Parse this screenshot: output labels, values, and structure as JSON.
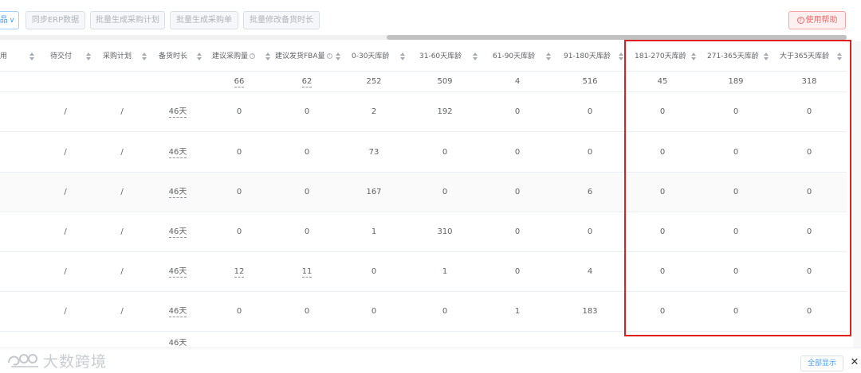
{
  "toolbar": {
    "filter_label": "品",
    "buttons": [
      "同步ERP数据",
      "批量生成采购计划",
      "批量生成采购单",
      "批量修改备货时长"
    ],
    "help_label": "使用帮助"
  },
  "table": {
    "columns": [
      "用",
      "待交付",
      "采购计划",
      "备货时长",
      "建议采购量",
      "建议发货FBA量",
      "0-30天库龄",
      "31-60天库龄",
      "61-90天库龄",
      "91-180天库龄",
      "181-270天库龄",
      "271-365天库龄",
      "大于365天库龄"
    ],
    "totals": [
      "",
      "",
      "",
      "",
      "66",
      "62",
      "252",
      "509",
      "4",
      "516",
      "45",
      "189",
      "318"
    ],
    "rows": [
      [
        "",
        "/",
        "/",
        "46天",
        "0",
        "0",
        "2",
        "192",
        "0",
        "0",
        "0",
        "0",
        "0"
      ],
      [
        "",
        "/",
        "/",
        "46天",
        "0",
        "0",
        "73",
        "0",
        "0",
        "0",
        "0",
        "0",
        "0"
      ],
      [
        "",
        "/",
        "/",
        "46天",
        "0",
        "0",
        "167",
        "0",
        "0",
        "6",
        "0",
        "0",
        "0"
      ],
      [
        "",
        "/",
        "/",
        "46天",
        "0",
        "0",
        "1",
        "310",
        "0",
        "0",
        "0",
        "0",
        "0"
      ],
      [
        "",
        "/",
        "/",
        "46天",
        "12",
        "11",
        "0",
        "1",
        "0",
        "4",
        "0",
        "0",
        "0"
      ],
      [
        "",
        "/",
        "/",
        "46天",
        "0",
        "0",
        "0",
        "0",
        "1",
        "183",
        "0",
        "0",
        "0"
      ],
      [
        "",
        "",
        "",
        "46天",
        "",
        "",
        "",
        "",
        "",
        "",
        "",
        "",
        ""
      ]
    ]
  },
  "footer": {
    "watermark": "大数跨境",
    "show_all_label": "全部显示",
    "close_label": "✕"
  }
}
